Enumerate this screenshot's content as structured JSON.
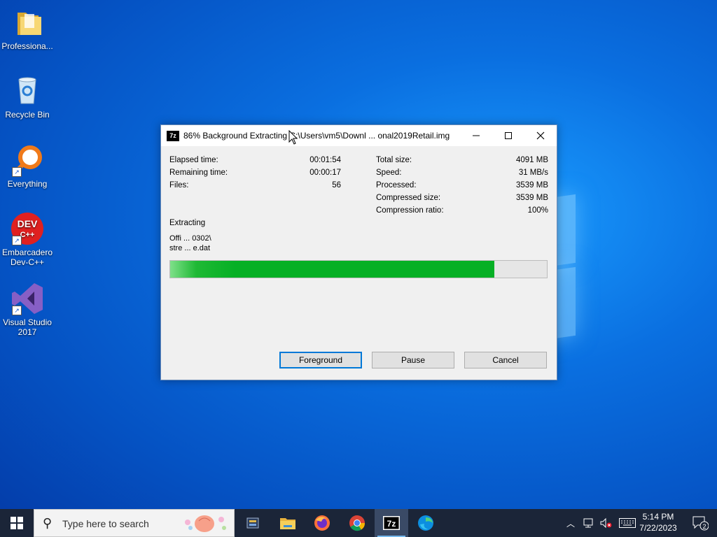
{
  "desktop": {
    "icons": [
      {
        "label": "Professiona...",
        "icon": "folder-icon"
      },
      {
        "label": "Recycle Bin",
        "icon": "recycle-bin-icon"
      },
      {
        "label": "Everything",
        "icon": "everything-search-icon"
      },
      {
        "label": "Embarcadero Dev-C++",
        "icon": "devcpp-icon",
        "glyph": "DEV C++"
      },
      {
        "label": "Visual Studio 2017",
        "icon": "visual-studio-icon"
      }
    ]
  },
  "dialog": {
    "app_badge": "7z",
    "title": "86% Background Extracting C:\\Users\\vm5\\Downl ... onal2019Retail.img",
    "left_stats": [
      {
        "label": "Elapsed time:",
        "value": "00:01:54"
      },
      {
        "label": "Remaining time:",
        "value": "00:00:17"
      },
      {
        "label": "Files:",
        "value": "56"
      }
    ],
    "right_stats": [
      {
        "label": "Total size:",
        "value": "4091 MB"
      },
      {
        "label": "Speed:",
        "value": "31 MB/s"
      },
      {
        "label": "Processed:",
        "value": "3539 MB"
      },
      {
        "label": "Compressed size:",
        "value": "3539 MB"
      },
      {
        "label": "Compression ratio:",
        "value": "100%"
      }
    ],
    "status_label": "Extracting",
    "path_line1": "Offi ... 0302\\",
    "path_line2": "stre ... e.dat",
    "progress": 0.86,
    "progress_color": "#06b025",
    "buttons": {
      "foreground": "Foreground",
      "pause": "Pause",
      "cancel": "Cancel"
    }
  },
  "taskbar": {
    "search_placeholder": "Type here to search",
    "apps": [
      "task-view",
      "file-explorer",
      "firefox",
      "chrome",
      "7-zip",
      "edge"
    ],
    "clock_time": "5:14 PM",
    "clock_date": "7/22/2023",
    "notification_count": "2"
  }
}
